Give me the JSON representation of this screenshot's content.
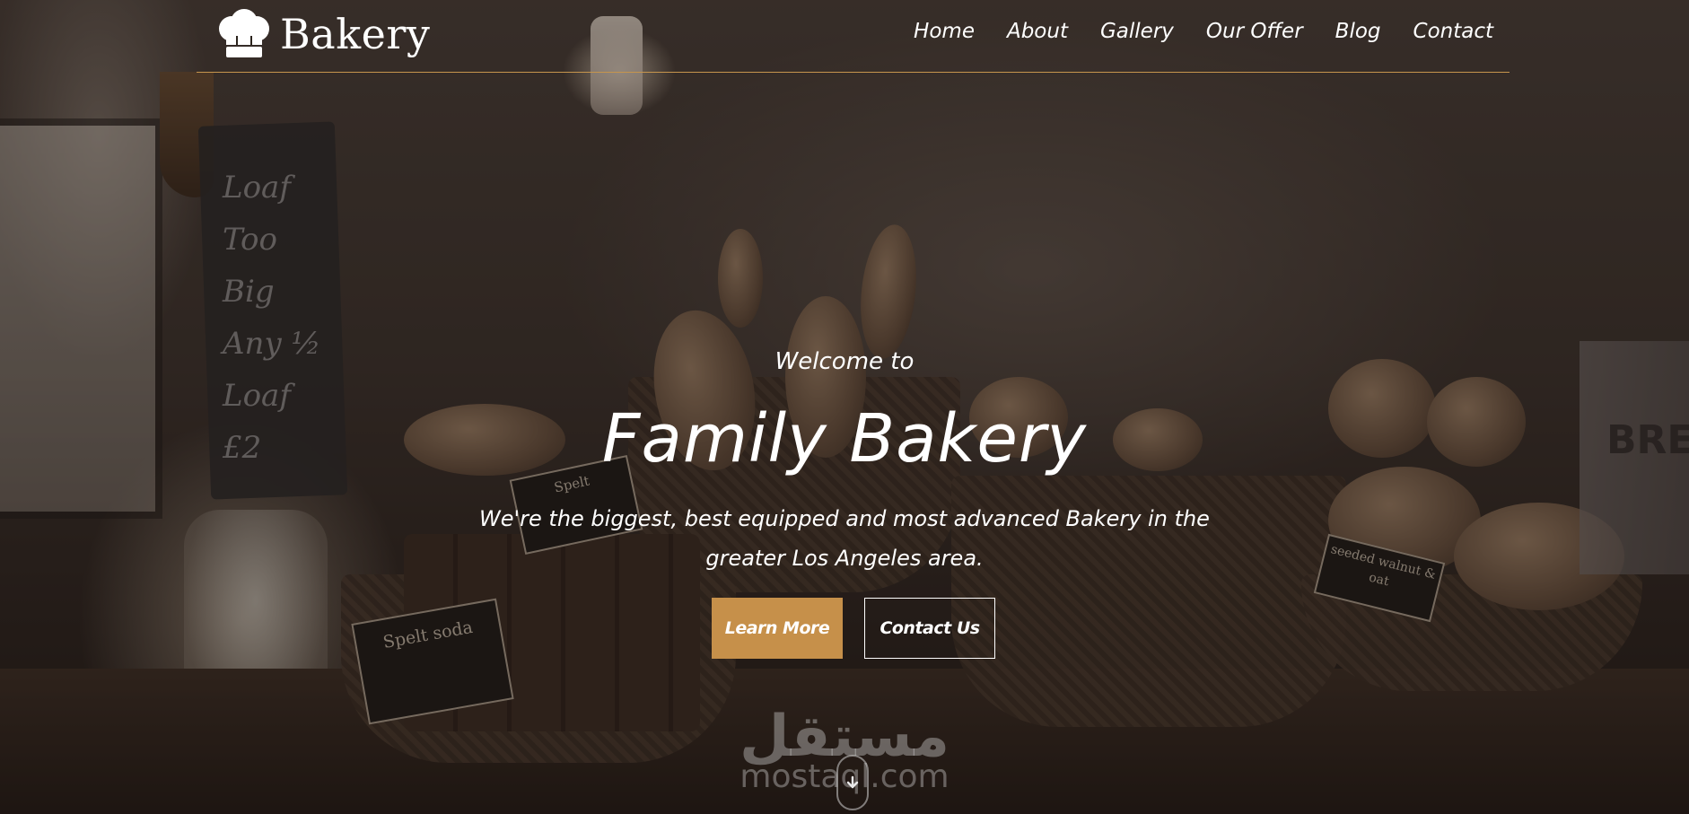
{
  "header": {
    "logo_text": "Bakery",
    "logo_icon": "chef-hat-icon",
    "nav": [
      {
        "label": "Home"
      },
      {
        "label": "About"
      },
      {
        "label": "Gallery"
      },
      {
        "label": "Our Offer"
      },
      {
        "label": "Blog"
      },
      {
        "label": "Contact"
      }
    ]
  },
  "hero": {
    "welcome": "Welcome to",
    "title": "Family Bakery",
    "subtitle": "We're the biggest, best equipped and most advanced Bakery in the greater Los Angeles area.",
    "buttons": {
      "learn_more": "Learn More",
      "contact_us": "Contact Us"
    },
    "scroll_icon": "arrow-down-icon"
  },
  "background": {
    "chalkboard_text": [
      "Loaf Too",
      "Big",
      "Any ½",
      "Loaf £2"
    ],
    "tags": [
      "Spelt soda",
      "Spelt",
      "seeded walnut & oat"
    ],
    "bin_text": "BRE"
  },
  "watermark": {
    "arabic": "مستقل",
    "latin": "mostaql.com"
  },
  "colors": {
    "accent": "#c6904a",
    "divider": "#c6954d",
    "text": "#ffffff"
  }
}
